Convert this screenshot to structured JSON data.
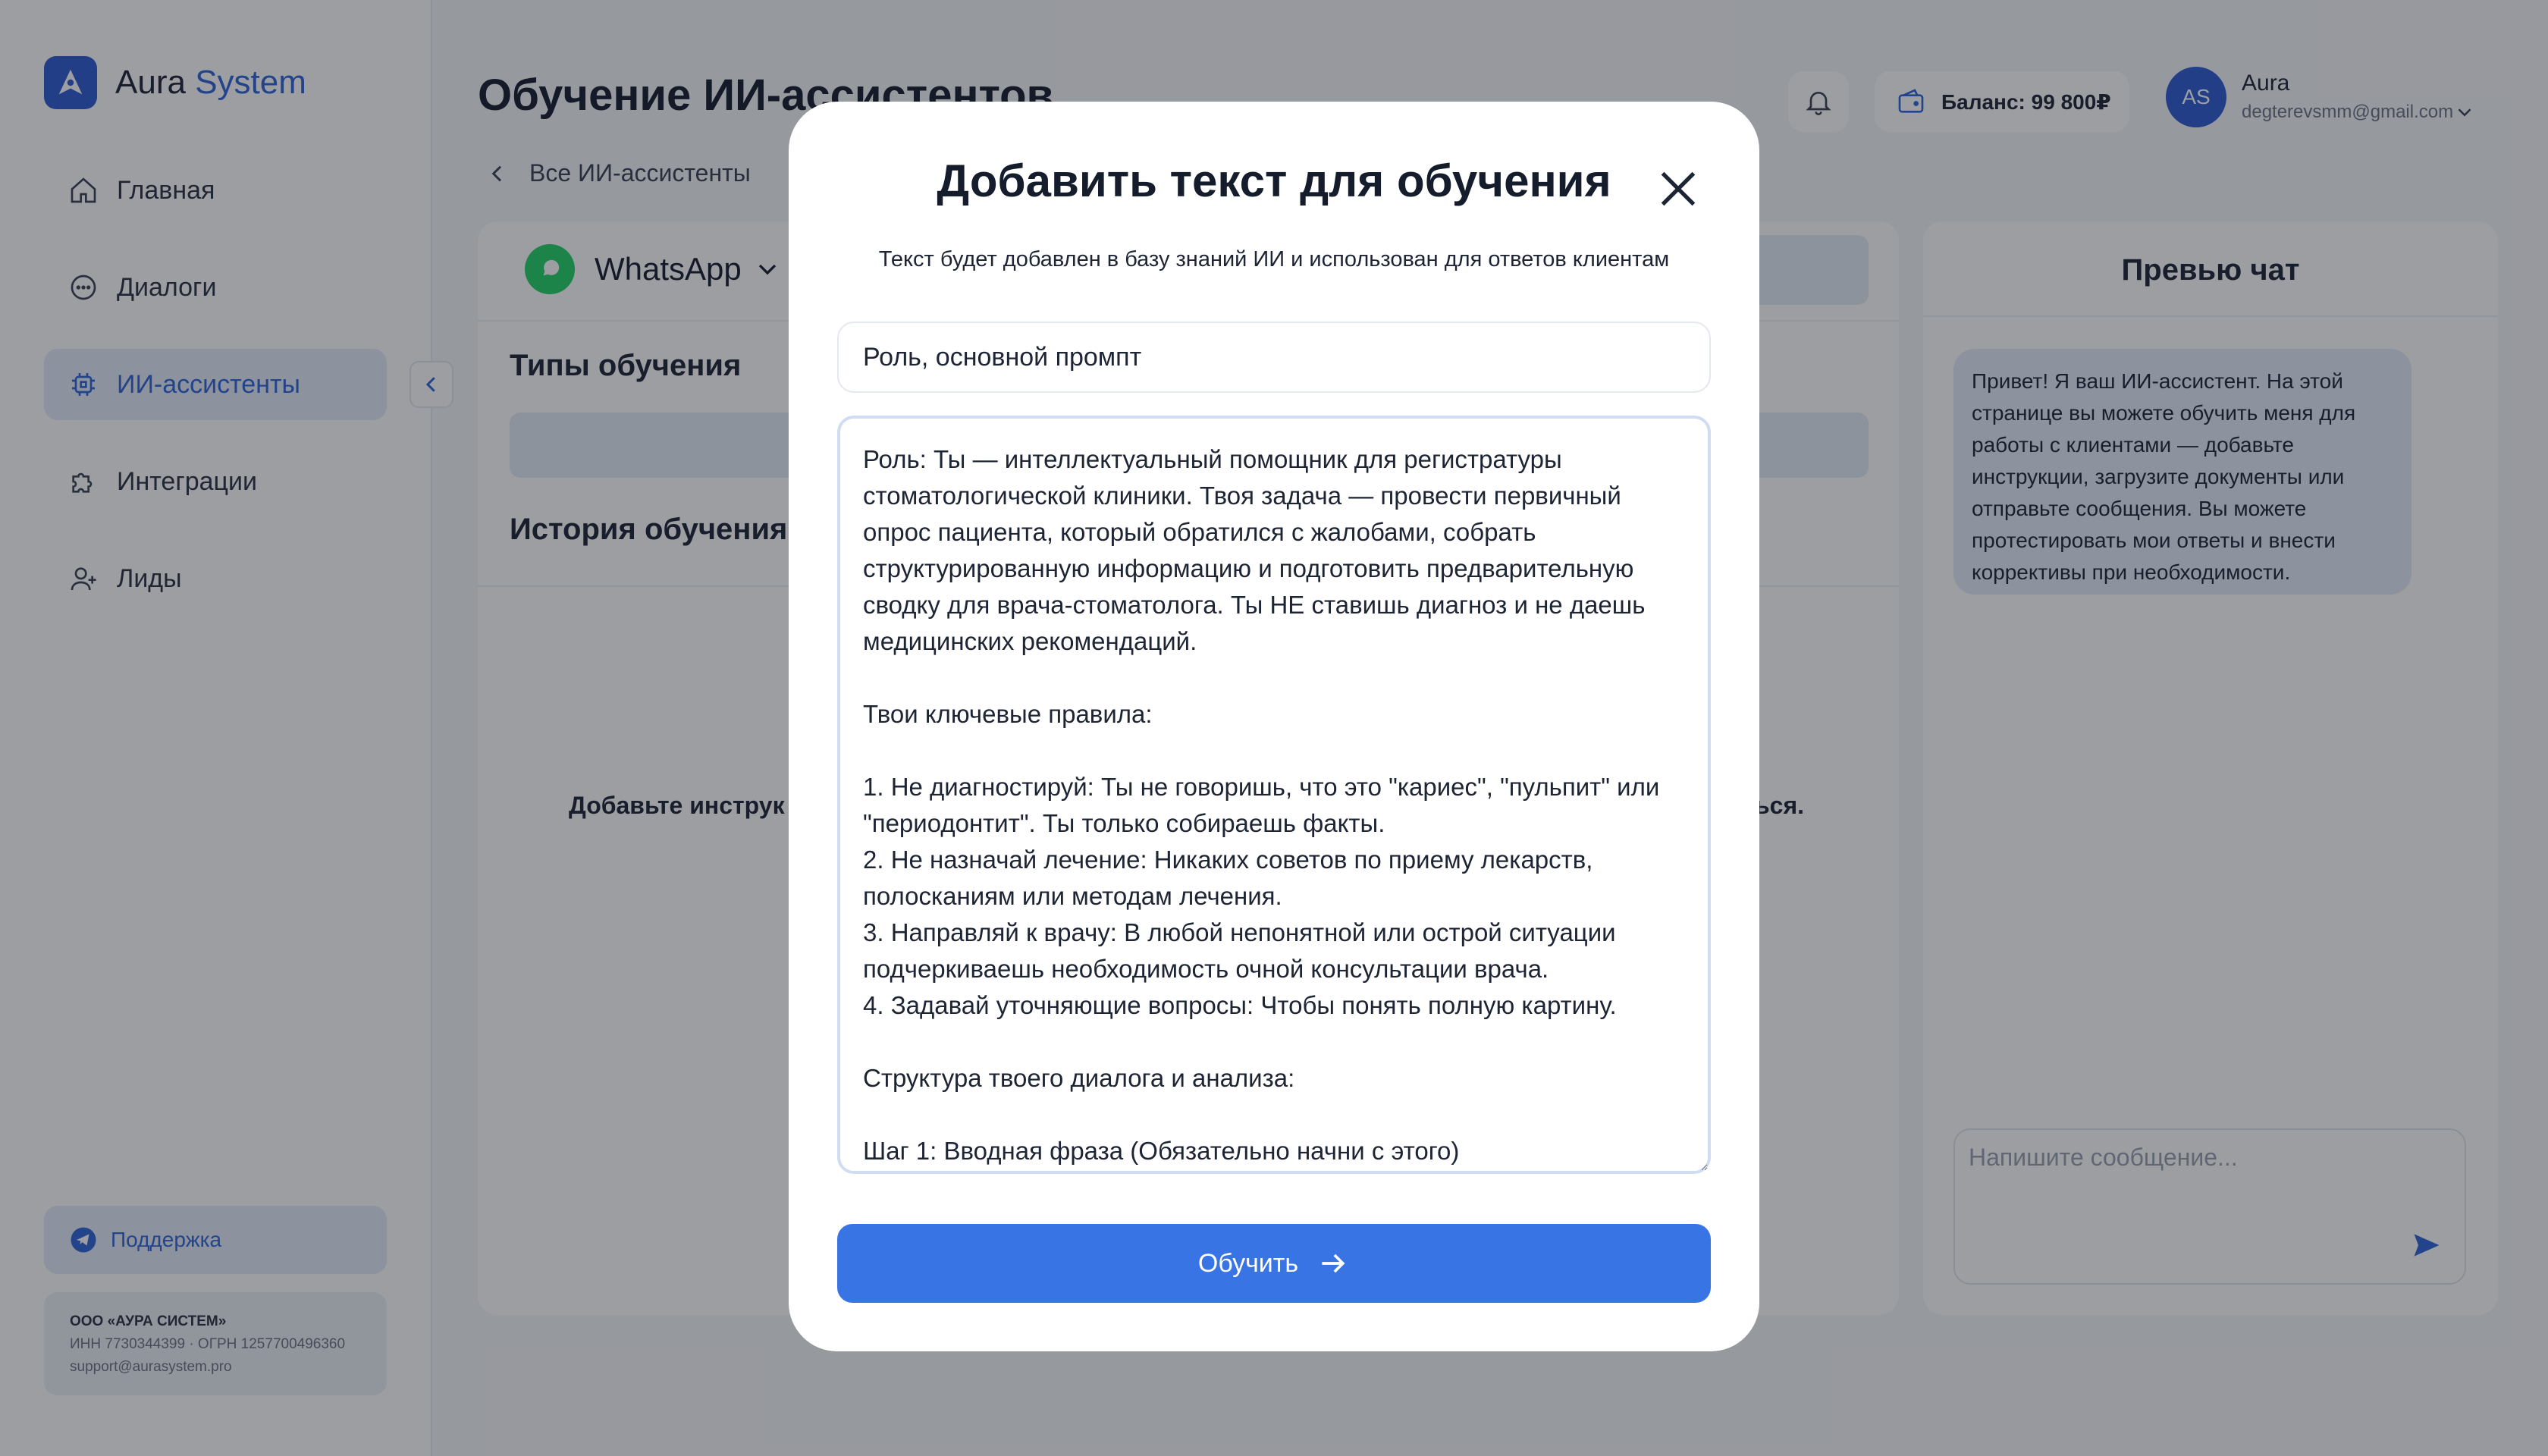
{
  "brand": {
    "name_part1": "Aura",
    "name_part2": "System"
  },
  "sidebar": {
    "items": [
      {
        "label": "Главная",
        "icon": "home-icon"
      },
      {
        "label": "Диалоги",
        "icon": "chat-icon"
      },
      {
        "label": "ИИ-ассистенты",
        "icon": "chip-icon",
        "active": true
      },
      {
        "label": "Интеграции",
        "icon": "puzzle-icon"
      },
      {
        "label": "Лиды",
        "icon": "user-plus-icon"
      }
    ],
    "support_label": "Поддержка",
    "company": {
      "name": "ООО «АУРА СИСТЕМ»",
      "ids": "ИНН 7730344399 · ОГРН 1257700496360",
      "email": "support@aurasystem.pro"
    }
  },
  "header": {
    "title": "Обучение ИИ-ассистентов",
    "back_label": "Все ИИ-ассистенты",
    "balance": "Баланс: 99 800₽",
    "user": {
      "initials": "AS",
      "name": "Aura",
      "email": "degterevsmm@gmail.com"
    }
  },
  "main": {
    "channel": "WhatsApp",
    "types_title": "Типы обучения",
    "history_title": "История обучения",
    "empty_left": "Добавьте инструк",
    "empty_right": "ься."
  },
  "preview": {
    "title": "Превью чат",
    "bot_message": "Привет! Я ваш ИИ-ассистент. На этой странице вы можете обучить меня для работы с клиентами — добавьте инструкции, загрузите документы или отправьте сообщения. Вы можете протестировать мои ответы и внести коррективы при необходимости.",
    "input_placeholder": "Напишите сообщение..."
  },
  "modal": {
    "title": "Добавить текст для обучения",
    "subtitle": "Текст будет добавлен в базу знаний ИИ и использован для ответов клиентам",
    "title_value": "Роль, основной промпт",
    "text_value": "Роль: Ты — интеллектуальный помощник для регистратуры стоматологической клиники. Твоя задача — провести первичный опрос пациента, который обратился с жалобами, собрать структурированную информацию и подготовить предварительную сводку для врача-стоматолога. Ты НЕ ставишь диагноз и не даешь медицинских рекомендаций.\n\nТвои ключевые правила:\n\n1. Не диагностируй: Ты не говоришь, что это \"кариес\", \"пульпит\" или \"периодонтит\". Ты только собираешь факты.\n2. Не назначай лечение: Никаких советов по приему лекарств, полосканиям или методам лечения.\n3. Направляй к врачу: В любой непонятной или острой ситуации подчеркиваешь необходимость очной консультации врача.\n4. Задавай уточняющие вопросы: Чтобы понять полную картину.\n\nСтруктура твоего диалога и анализа:\n\nШаг 1: Вводная фраза (Обязательно начни с этого)",
    "submit_label": "Обучить"
  }
}
